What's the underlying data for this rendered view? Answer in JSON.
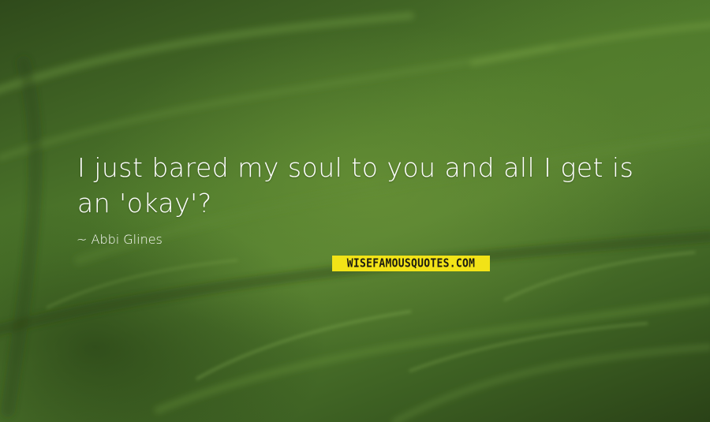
{
  "quote": {
    "text": "I just bared my soul to you and all I get is an 'okay'?",
    "author": "~ Abbi Glines"
  },
  "brand": {
    "logo_text": "WISEFAMOUSQUOTES.COM",
    "logo_color": "#f2e317"
  },
  "background": {
    "description_color": "#4f7a2c"
  }
}
